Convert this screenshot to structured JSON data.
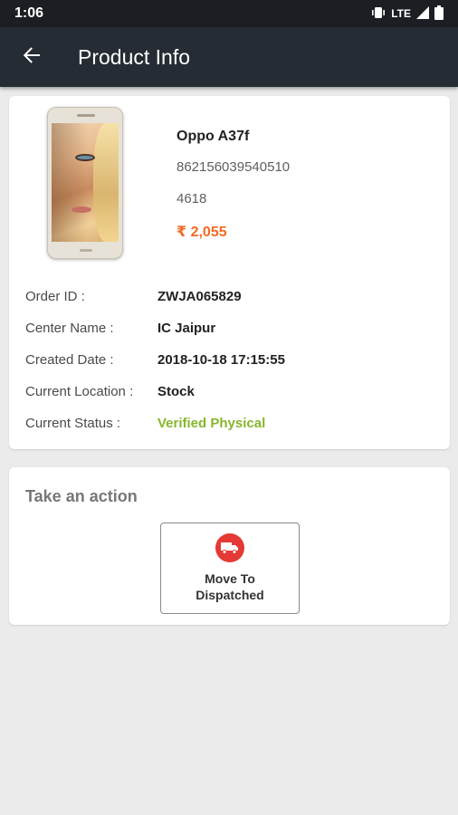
{
  "status_bar": {
    "time": "1:06",
    "network": "LTE"
  },
  "app_bar": {
    "title": "Product Info",
    "back_icon": "arrow-left-icon"
  },
  "product": {
    "name": "Oppo A37f",
    "imei": "862156039540510",
    "code": "4618",
    "price": "₹ 2,055"
  },
  "details": [
    {
      "label": "Order ID :",
      "value": "ZWJA065829"
    },
    {
      "label": "Center Name :",
      "value": "IC Jaipur"
    },
    {
      "label": "Created Date :",
      "value": "2018-10-18 17:15:55"
    },
    {
      "label": "Current Location :",
      "value": "Stock"
    },
    {
      "label": "Current Status :",
      "value": "Verified Physical"
    }
  ],
  "action": {
    "title": "Take an action",
    "button_label": "Move To Dispatched",
    "button_icon": "truck-icon"
  },
  "colors": {
    "app_bar": "#252c33",
    "status_bar": "#1b1f23",
    "price": "#f26a24",
    "status_verified": "#86b62e",
    "action_icon": "#e53935"
  }
}
